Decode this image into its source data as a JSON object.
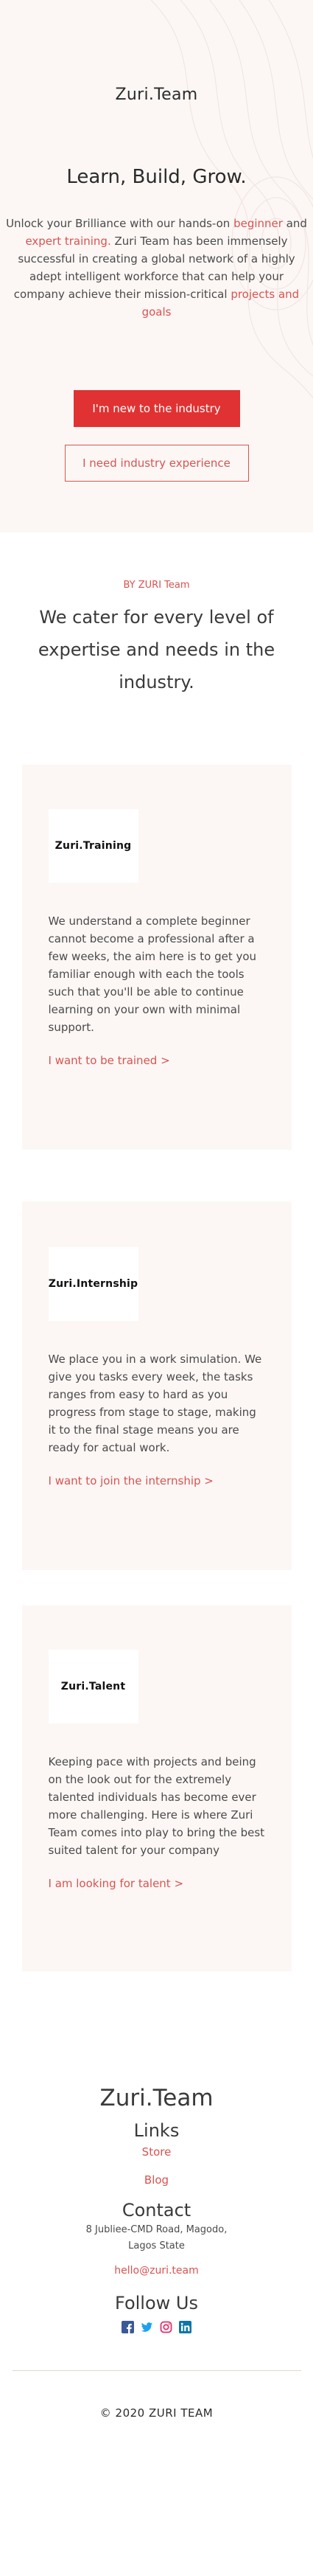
{
  "brand": "Zuri.Team",
  "hero": {
    "title": "Learn, Build, Grow.",
    "text_1": "Unlock your Brilliance with our hands-on ",
    "link_beginner": "beginner",
    "text_2": " and ",
    "link_expert": "expert training.",
    "text_3": " Zuri Team has been immensely successful in creating a global network of a highly adept intelligent workforce that can help your company achieve their mission-critical ",
    "link_projects": "projects and goals",
    "primary_button": "I'm new to the industry",
    "secondary_button": "I need industry experience"
  },
  "intro": {
    "by_line": "BY ZURI Team",
    "title": "We cater for every level of expertise and needs in the industry."
  },
  "cards": [
    {
      "logo": "Zuri.Training",
      "text": "We understand a complete beginner cannot become a professional after a few weeks, the aim here is to get you familiar enough with each the tools such that you'll be able to continue learning on your own with minimal support.",
      "link": "I want to be trained >"
    },
    {
      "logo": "Zuri.Internship",
      "text": "We place you in a work simulation. We give you tasks every week, the tasks ranges from easy to hard as you progress from stage to stage, making it to the final stage means you are ready for actual work.",
      "link": "I want to join the internship >"
    },
    {
      "logo": "Zuri.Talent",
      "text": "Keeping pace with projects and being on the look out for the extremely talented individuals has become ever more challenging. Here is where Zuri Team comes into play to bring the best suited talent for your company",
      "link": "I am looking for talent >"
    }
  ],
  "footer": {
    "brand": "Zuri.Team",
    "links_heading": "Links",
    "links": [
      "Store",
      "Blog"
    ],
    "contact_heading": "Contact",
    "address": "8 Jubliee-CMD Road, Magodo, Lagos State",
    "email": "hello@zuri.team",
    "follow_heading": "Follow Us",
    "socials": [
      {
        "name": "facebook-icon",
        "color": "#3b5998"
      },
      {
        "name": "twitter-icon",
        "color": "#1da1f2"
      },
      {
        "name": "instagram-icon",
        "color": "#e1306c"
      },
      {
        "name": "linkedin-icon",
        "color": "#0e76a8"
      }
    ],
    "copyright": "© 2020 ZURI TEAM"
  },
  "colors": {
    "accent": "#d9534f",
    "primary_button": "#e03232",
    "hero_background": "#fcf7f5"
  }
}
